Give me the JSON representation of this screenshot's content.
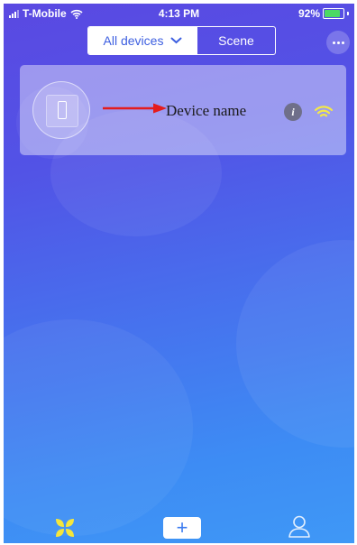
{
  "status_bar": {
    "carrier": "T-Mobile",
    "time": "4:13 PM",
    "battery": "92%",
    "battery_level": 0.92,
    "battery_fill_color": "#4cd964"
  },
  "header": {
    "segments": [
      {
        "label": "All devices",
        "selected": true,
        "icon": "chevron-down-icon"
      },
      {
        "label": "Scene",
        "selected": false
      }
    ],
    "more_icon": "more-dots-icon"
  },
  "device": {
    "name": "Device name",
    "icon": "smartphone-icon",
    "info_icon": "info-icon",
    "info_glyph": "i",
    "wifi_icon": "wifi-icon",
    "wifi_color": "#f3e84a",
    "arrow_color": "#e41c1c"
  },
  "tabbar": {
    "items": [
      {
        "name": "home",
        "icon": "home-clover-icon",
        "color": "#f5e63c"
      },
      {
        "name": "add",
        "icon": "plus-icon",
        "glyph": "+"
      },
      {
        "name": "user",
        "icon": "user-icon"
      }
    ]
  },
  "colors": {
    "gradient_top": "#5a49e2",
    "gradient_bottom": "#3f98f6",
    "accent": "#3d5fe0"
  }
}
